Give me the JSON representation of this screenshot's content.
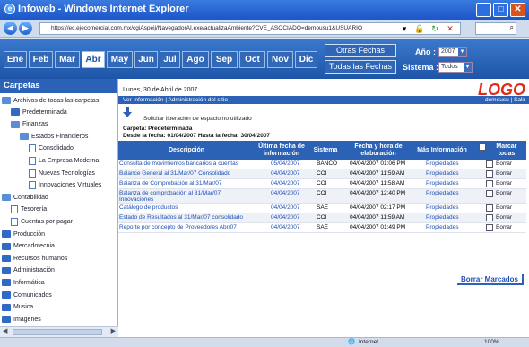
{
  "window": {
    "title": "Infoweb - Windows Internet Explorer"
  },
  "address": {
    "url": "https://ec.ejecomercial.com.mx/cgiAspeij/NavegadorAI.exe/actualizaAmbiente?CVE_ASOCIADO=demousu1&USUARIO"
  },
  "months": [
    "Ene",
    "Feb",
    "Mar",
    "Abr",
    "May",
    "Jun",
    "Jul",
    "Ago",
    "Sep",
    "Oct",
    "Nov",
    "Dic"
  ],
  "active_month": "Abr",
  "filters": {
    "otras_fechas": "Otras Fechas",
    "todas_fechas": "Todas las Fechas",
    "anio_label": "Año :",
    "anio_value": "2007",
    "sistema_label": "Sistema :",
    "sistema_value": "Todos"
  },
  "sidebar": {
    "title": "Carpetas",
    "root": "Archivos de todas las carpetas",
    "items": [
      "Predeterminada",
      "Finanzas",
      "Estados Financieros",
      "Consolidado",
      "La Empresa Moderna",
      "Nuevas Tecnologías",
      "Innovaciones Virtuales",
      "Contabilidad",
      "Tesorería",
      "Cuentas por pagar",
      "Producción",
      "Mercadotecnia",
      "Recursos humanos",
      "Administración",
      "Informática",
      "Comunicados",
      "Musica",
      "Imagenes"
    ]
  },
  "header": {
    "date": "Lunes, 30 de Abril de 2007",
    "logo": "LOGO",
    "nav_left": "Ver Información | Administración del sitio",
    "nav_right": "demousu | Salir"
  },
  "info": {
    "solicitar": "Solicitar liberación de espacio no utilizado",
    "carpeta": "Carpeta: Predeterminada",
    "desde": "Desde la fecha: 01/04/2007 Hasta la fecha: 30/04/2007"
  },
  "table": {
    "headers": {
      "descripcion": "Descripción",
      "ultima": "Última fecha de información",
      "sistema": "Sistema",
      "fecha_hora": "Fecha y hora de elaboración",
      "mas": "Más Información",
      "marcar": "Marcar todas"
    },
    "rows": [
      {
        "desc": "Consulta de movimientos bancarios a cuentas",
        "fecha": "05/04/2007",
        "sistema": "BANCO",
        "elab": "04/04/2007 01:06 PM",
        "mas": "Propiedades",
        "borrar": "Borrar"
      },
      {
        "desc": "Balance General al 31/Mar/07 Consolidado",
        "fecha": "04/04/2007",
        "sistema": "COI",
        "elab": "04/04/2007 11:59 AM",
        "mas": "Propiedades",
        "borrar": "Borrar"
      },
      {
        "desc": "Balanza de Comprobación al 31/Mar/07",
        "fecha": "04/04/2007",
        "sistema": "COI",
        "elab": "04/04/2007 11:58 AM",
        "mas": "Propiedades",
        "borrar": "Borrar"
      },
      {
        "desc": "Balanza de comprobación al 31/Mar/07 Innovaciones",
        "fecha": "04/04/2007",
        "sistema": "COI",
        "elab": "04/04/2007 12:40 PM",
        "mas": "Propiedades",
        "borrar": "Borrar"
      },
      {
        "desc": "Catálogo de productos",
        "fecha": "04/04/2007",
        "sistema": "SAE",
        "elab": "04/04/2007 02:17 PM",
        "mas": "Propiedades",
        "borrar": "Borrar"
      },
      {
        "desc": "Estado de Resultados al 31/Mar/07 consolidado",
        "fecha": "04/04/2007",
        "sistema": "COI",
        "elab": "04/04/2007 11:59 AM",
        "mas": "Propiedades",
        "borrar": "Borrar"
      },
      {
        "desc": "Reporte por concepto de Proveedores Abr/07",
        "fecha": "04/04/2007",
        "sistema": "SAE",
        "elab": "04/04/2007 01:49 PM",
        "mas": "Propiedades",
        "borrar": "Borrar"
      }
    ],
    "borrar_marcados": "Borrar Marcados"
  },
  "status": {
    "zone": "Internet",
    "zoom": "100%"
  }
}
